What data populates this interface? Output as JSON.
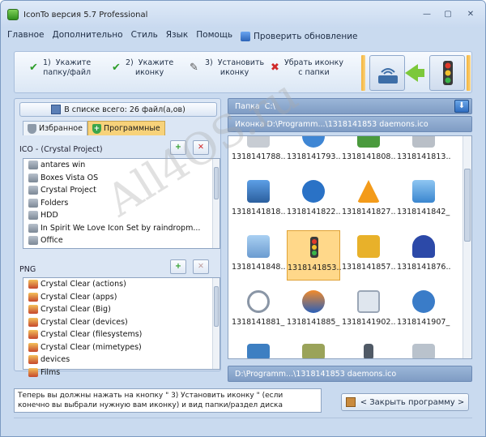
{
  "window": {
    "title": "IconTo версия 5.7 Professional",
    "min": "—",
    "max": "▢",
    "close": "✕"
  },
  "menu": [
    "Главное",
    "Дополнительно",
    "Стиль",
    "Язык",
    "Помощь"
  ],
  "menu_update": "Проверить обновление",
  "toolbar": {
    "step1": "1)  Укажите\nпапку/файл",
    "step2": "2)  Укажите\nиконку",
    "step3": "3)  Установить\nиконку",
    "remove": "Убрать иконку\nс папки"
  },
  "left": {
    "count_label": "В списке всего: 26 файл(а,ов)",
    "tabs": [
      "Избранное",
      "Программные"
    ],
    "ico_header": "ICO - (Crystal Project)",
    "ico_items": [
      "antares win",
      "Boxes Vista OS",
      "Crystal Project",
      "Folders",
      "HDD",
      "In Spirit We Love Icon Set by raindropm...",
      "Office"
    ],
    "png_header": "PNG",
    "png_items": [
      "Crystal Clear (actions)",
      "Crystal Clear (apps)",
      "Crystal Clear (Big)",
      "Crystal Clear (devices)",
      "Crystal Clear (filesystems)",
      "Crystal Clear (mimetypes)",
      "devices",
      "Films"
    ]
  },
  "right": {
    "folder_label": "Папка",
    "folder_value": "C:\\",
    "icon_path": "Иконка  D:\\Programm...\\1318141853  daemons.ico",
    "bottom_path": "D:\\Programm...\\1318141853  daemons.ico",
    "icons": [
      "1318141788...",
      "1318141793...",
      "1318141808...",
      "1318141813...",
      "1318141818...",
      "1318141822...",
      "1318141827...",
      "1318141842_...",
      "1318141848...",
      "1318141853...",
      "1318141857...",
      "1318141876...",
      "1318141881_...",
      "1318141885_...",
      "1318141902...",
      "1318141907_..."
    ]
  },
  "status": "Теперь вы должны нажать на кнопку \" 3)  Установить иконку \" (если конечно вы выбрали нужную вам иконку) и вид папки/раздел диска примет -",
  "close_button": "< Закрыть программу >",
  "watermark": "All4OS.ru"
}
